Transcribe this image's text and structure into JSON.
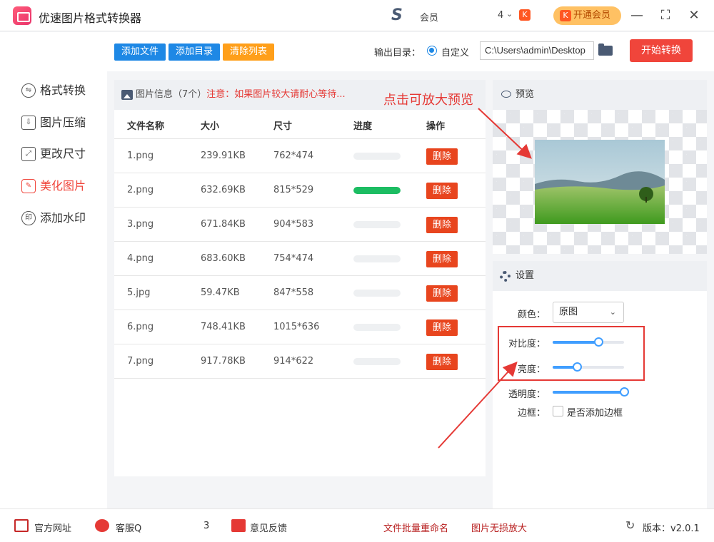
{
  "app": {
    "title": "优速图片格式转换器"
  },
  "user": {
    "name": "会员",
    "count": "4",
    "vip_label": "开通会员"
  },
  "sidebar": {
    "items": [
      {
        "label": "格式转换",
        "icon": "format-convert-icon"
      },
      {
        "label": "图片压缩",
        "icon": "compress-icon"
      },
      {
        "label": "更改尺寸",
        "icon": "resize-icon"
      },
      {
        "label": "美化图片",
        "icon": "beautify-icon",
        "active": true
      },
      {
        "label": "添加水印",
        "icon": "watermark-icon"
      }
    ]
  },
  "toolbar": {
    "add_file": "添加文件",
    "add_dir": "添加目录",
    "clear_list": "清除列表",
    "output_label": "输出目录：",
    "radio_label": "自定义",
    "path_value": "C:\\Users\\admin\\Desktop",
    "start": "开始转换"
  },
  "file_panel": {
    "header_info": "图片信息（7个）",
    "header_note": "注意：如果图片较大请耐心等待...",
    "columns": [
      "文件名称",
      "大小",
      "尺寸",
      "进度",
      "操作"
    ],
    "delete_label": "删除",
    "rows": [
      {
        "name": "1.png",
        "size": "239.91KB",
        "dims": "762*474",
        "progress": 0
      },
      {
        "name": "2.png",
        "size": "632.69KB",
        "dims": "815*529",
        "progress": 1
      },
      {
        "name": "3.png",
        "size": "671.84KB",
        "dims": "904*583",
        "progress": 0
      },
      {
        "name": "4.png",
        "size": "683.60KB",
        "dims": "754*474",
        "progress": 0
      },
      {
        "name": "5.jpg",
        "size": "59.47KB",
        "dims": "847*558",
        "progress": 0
      },
      {
        "name": "6.png",
        "size": "748.41KB",
        "dims": "1015*636",
        "progress": 0
      },
      {
        "name": "7.png",
        "size": "917.78KB",
        "dims": "914*622",
        "progress": 0
      }
    ]
  },
  "preview": {
    "title": "预览",
    "annotation": "点击可放大预览"
  },
  "settings": {
    "title": "设置",
    "color_label": "颜色：",
    "color_value": "原图",
    "contrast_label": "对比度：",
    "contrast_value": 0.64,
    "brightness_label": "亮度：",
    "brightness_value": 0.34,
    "opacity_label": "透明度：",
    "opacity_value": 1.0,
    "border_label": "边框：",
    "border_checkbox": "是否添加边框"
  },
  "footer": {
    "website": "官方网址",
    "support": "客服Q",
    "support_tail": "3",
    "feedback": "意见反馈",
    "batch_rename": "文件批量重命名",
    "lossless": "图片无损放大",
    "version": "版本：v2.0.1"
  },
  "colors": {
    "accent": "#f0453b",
    "blue": "#1e88e5",
    "green": "#1cbd62",
    "orange": "#ff9f1a"
  }
}
